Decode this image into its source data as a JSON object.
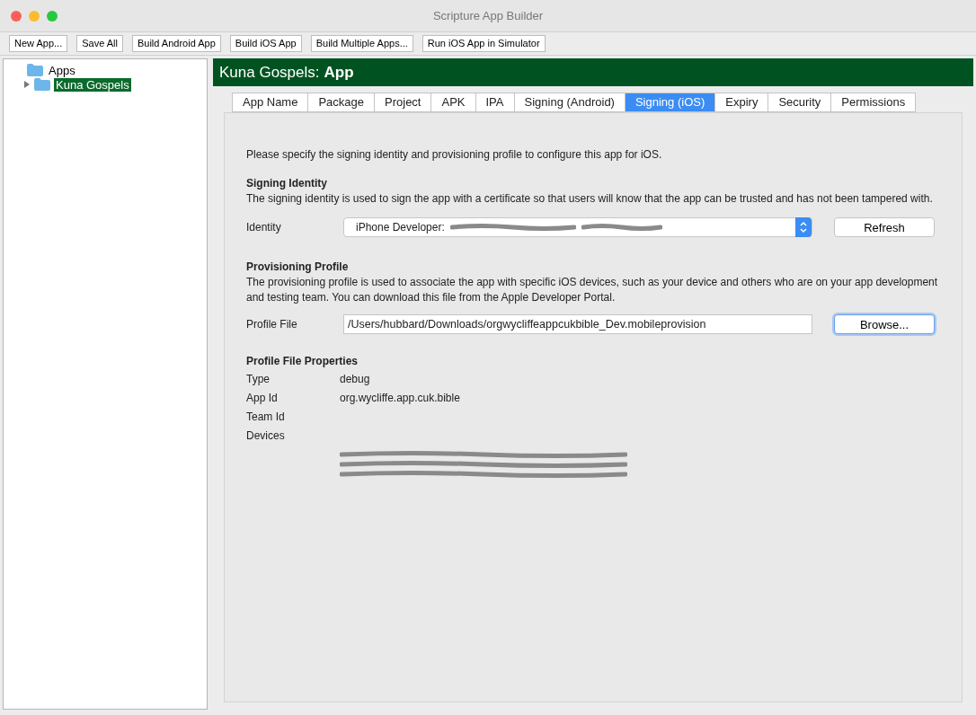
{
  "window": {
    "title": "Scripture App Builder"
  },
  "toolbar": [
    "New App...",
    "Save All",
    "Build Android App",
    "Build iOS App",
    "Build Multiple Apps...",
    "Run iOS App in Simulator"
  ],
  "tree": [
    {
      "label": "Apps",
      "expanded": true,
      "selected": false,
      "children": [
        {
          "label": "Kuna Gospels",
          "expanded": false,
          "selected": true
        }
      ]
    }
  ],
  "header": {
    "name": "Kuna Gospels:",
    "section": "App"
  },
  "tabs": [
    {
      "label": "App Name",
      "selected": false
    },
    {
      "label": "Package",
      "selected": false
    },
    {
      "label": "Project",
      "selected": false
    },
    {
      "label": "APK",
      "selected": false
    },
    {
      "label": "IPA",
      "selected": false
    },
    {
      "label": "Signing (Android)",
      "selected": false
    },
    {
      "label": "Signing (iOS)",
      "selected": true
    },
    {
      "label": "Expiry",
      "selected": false
    },
    {
      "label": "Security",
      "selected": false
    },
    {
      "label": "Permissions",
      "selected": false
    }
  ],
  "intro": "Please specify the signing identity and provisioning profile to configure this app for iOS.",
  "signing_identity": {
    "heading": "Signing Identity",
    "description": "The signing identity is used to sign the app with a certificate so that users will know that the app can be trusted and has not been tampered with.",
    "label": "Identity",
    "value": "iPhone Developer:",
    "button": "Refresh"
  },
  "provisioning_profile": {
    "heading": "Provisioning Profile",
    "description": "The provisioning profile is used to associate the app with specific iOS devices, such as your device and others who are on your app development and testing team. You can download this file from the Apple Developer Portal.",
    "label": "Profile File",
    "value": "/Users/hubbard/Downloads/orgwycliffeappcukbible_Dev.mobileprovision",
    "button": "Browse..."
  },
  "properties": {
    "heading": "Profile File Properties",
    "rows": [
      {
        "label": "Type",
        "value": "debug"
      },
      {
        "label": "App Id",
        "value": "org.wycliffe.app.cuk.bible"
      },
      {
        "label": "Team Id"
      },
      {
        "label": "Devices"
      }
    ],
    "devices": [
      {
        "kind": "redacted"
      },
      {
        "kind": "redacted"
      },
      {
        "kind": "redacted"
      }
    ]
  }
}
